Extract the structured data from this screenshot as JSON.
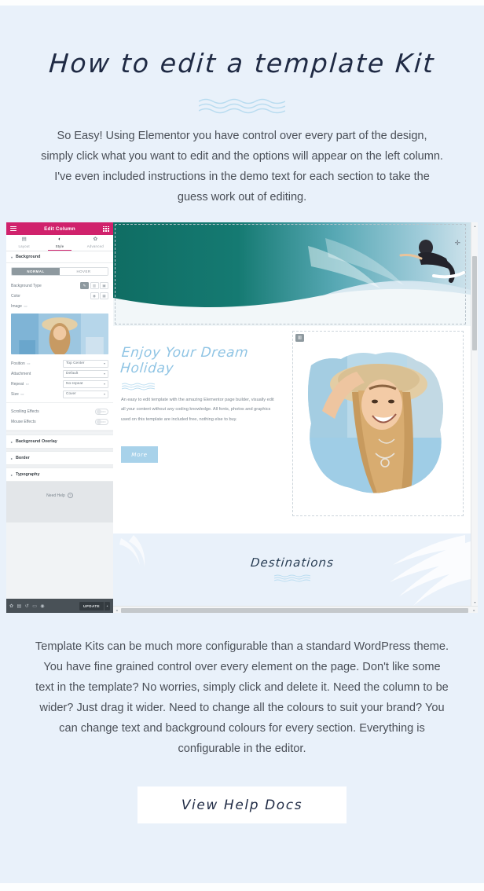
{
  "page": {
    "bg_color": "#e9f1fa",
    "heading": "How to edit a template Kit",
    "intro_paragraph": "So Easy! Using Elementor you have control over every part of the design, simply click what you want to edit and the options will appear on the left column.  I've even included instructions in the demo text for each section to take the guess work out of editing.",
    "outro_paragraph": "Template Kits can be much more configurable than a standard WordPress theme. You have fine grained control over every element on the page. Don't like some text in the template? No worries, simply click and  delete it. Need the column to be wider? Just drag it wider. Need to change all the colours to suit your brand? You can change text and background colours for every section. Everything is configurable in the editor.",
    "cta_label": "View Help Docs",
    "text_color": "#4a4f57",
    "heading_color": "#1f2a44",
    "wave_color": "#b9dcf0"
  },
  "editor": {
    "panel": {
      "header": {
        "title": "Edit Column",
        "bg_color": "#d0226c",
        "menu_icon": "hamburger-icon",
        "grid_icon": "grid-icon"
      },
      "tabs": [
        {
          "label": "Layout",
          "icon": "layout-icon",
          "active": false
        },
        {
          "label": "Style",
          "icon": "contrast-icon",
          "active": true
        },
        {
          "label": "Advanced",
          "icon": "gear-icon",
          "active": false
        }
      ],
      "active_tab": "Style",
      "accent_color": "#d0226c",
      "sections": {
        "background": {
          "title": "Background",
          "state_toggle": {
            "options": [
              "NORMAL",
              "HOVER"
            ],
            "selected": "NORMAL"
          },
          "rows": [
            {
              "label": "Background Type",
              "type": "buttons",
              "options": [
                "classic",
                "gradient",
                "slideshow"
              ],
              "selected": "classic"
            },
            {
              "label": "Color",
              "type": "color",
              "value": ""
            },
            {
              "label": "Image",
              "type": "image",
              "value": ""
            },
            {
              "label": "Position",
              "type": "select",
              "value": "Top Center"
            },
            {
              "label": "Attachment",
              "type": "select",
              "value": "Default"
            },
            {
              "label": "Repeat",
              "type": "select",
              "value": "No-repeat"
            },
            {
              "label": "Size",
              "type": "select",
              "value": "Cover"
            },
            {
              "label": "Scrolling Effects",
              "type": "switch",
              "value": "OFF"
            },
            {
              "label": "Mouse Effects",
              "type": "switch",
              "value": "OFF"
            }
          ]
        },
        "collapsed": [
          {
            "title": "Background Overlay"
          },
          {
            "title": "Border"
          },
          {
            "title": "Typography"
          }
        ]
      },
      "help": {
        "label": "Need Help",
        "icon": "question-circle-icon"
      },
      "footer": {
        "bg_color": "#495157",
        "icons": [
          "settings-icon",
          "trash-icon",
          "history-icon",
          "responsive-icon",
          "preview-icon"
        ],
        "update_label": "UPDATE",
        "caret_icon": "chevron-up-icon"
      }
    },
    "preview": {
      "hero_image_alt": "surfer-riding-wave",
      "add_section_icon": "plus-icon",
      "collapse_handle_icon": "chevron-left-icon",
      "widget_handle_icon": "columns-icon",
      "title": "Enjoy Your\nDream Holiday",
      "title_color": "#8fc4e4",
      "paragraph": "An easy to edit template with the amazing Elementor page builder, visually edit all your content without any coding knowledge. All fonts, photos and graphics used on this template are included free, nothing else to buy.",
      "button_label": "More",
      "button_color": "#a8d2ea",
      "photo_alt": "woman-in-sun-hat-laughing",
      "lower_section_title": "Destinations",
      "lower_section_bg": "#e9f1fa"
    },
    "scrollbars": {
      "vertical": {
        "up_arrow": "caret-up-icon",
        "down_arrow": "caret-down-icon"
      },
      "horizontal": {
        "left_arrow": "caret-left-icon",
        "right_arrow": "caret-right-icon"
      }
    }
  }
}
